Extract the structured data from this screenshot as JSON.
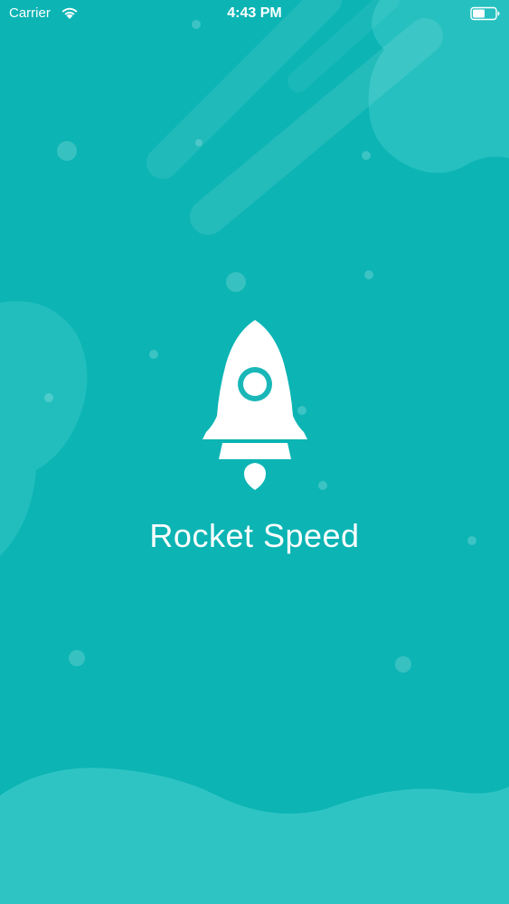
{
  "status_bar": {
    "carrier": "Carrier",
    "time": "4:43 PM",
    "wifi_icon": "wifi-icon",
    "battery_icon": "battery-icon"
  },
  "splash": {
    "logo_icon": "rocket-icon",
    "title": "Rocket Speed"
  },
  "colors": {
    "background": "#0cb4b4",
    "accent": "#1ab7b8",
    "foreground": "#ffffff"
  }
}
